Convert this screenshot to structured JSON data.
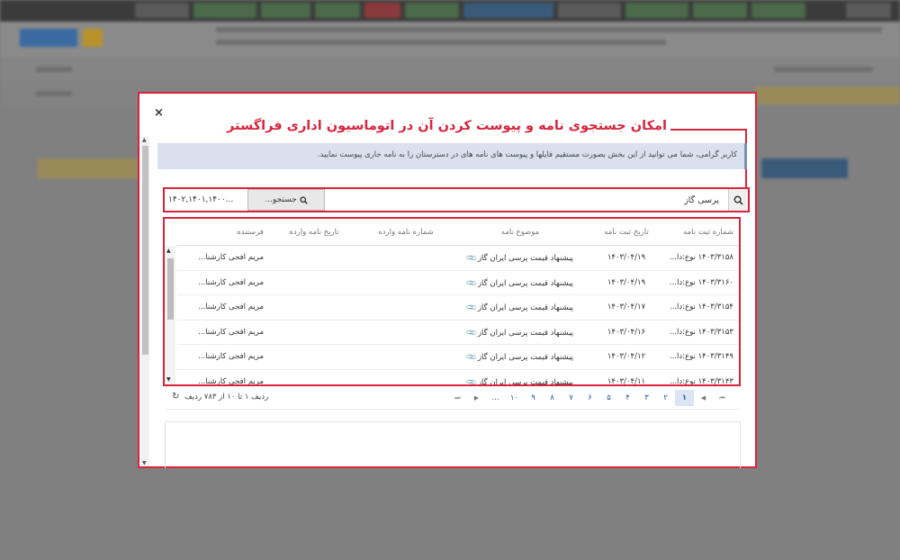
{
  "modal": {
    "close_label": "×",
    "headline": "امکان جستجوی نامه و پیوست کردن آن در اتوماسیون اداری فراگستر",
    "info": "کاربر گرامی، شما می توانید از این بخش بصورت مستقیم فایلها و پیوست های نامه های در دسترستان را به نامه جاری پیوست نمایید.",
    "search": {
      "value": "پرسی گاز",
      "button_label": "جستجو...",
      "year_value": "۱۴۰۲,۱۴۰۱,۱۴۰۰..."
    },
    "table": {
      "headers": [
        "شماره ثبت نامه",
        "تاریخ ثبت نامه",
        "موضوع نامه",
        "شماره نامه وارده",
        "تاریخ نامه وارده",
        "فرستنده"
      ],
      "rows": [
        {
          "number": "۱۴۰۳/۳۱۵۸ نوع:دا...",
          "date": "۱۴۰۳/۰۴/۱۹",
          "subject": "پیشنهاد قیمت پرسی ایران گاز",
          "in_number": "",
          "in_date": "",
          "sender": "مریم افجی کارشنا..."
        },
        {
          "number": "۱۴۰۳/۳۱۶۰ نوع:داخ...",
          "date": "۱۴۰۳/۰۴/۱۹",
          "subject": "پیشنهاد قیمت پرسی ایران گاز",
          "in_number": "",
          "in_date": "",
          "sender": "مریم افجی کارشنا..."
        },
        {
          "number": "۱۴۰۳/۳۱۵۴ نوع:دا...",
          "date": "۱۴۰۳/۰۴/۱۷",
          "subject": "پیشنهاد قیمت پرسی ایران گاز",
          "in_number": "",
          "in_date": "",
          "sender": "مریم افجی کارشنا..."
        },
        {
          "number": "۱۴۰۳/۳۱۵۳ نوع:دا...",
          "date": "۱۴۰۳/۰۴/۱۶",
          "subject": "پیشنهاد قیمت پرسی ایران گاز",
          "in_number": "",
          "in_date": "",
          "sender": "مریم افجی کارشنا..."
        },
        {
          "number": "۱۴۰۳/۳۱۴۹ نوع:دا...",
          "date": "۱۴۰۳/۰۴/۱۲",
          "subject": "پیشنهاد قیمت پرسی ایران گاز",
          "in_number": "",
          "in_date": "",
          "sender": "مریم افجی کارشنا..."
        },
        {
          "number": "۱۴۰۳/۳۱۴۳ نوع:دا...",
          "date": "۱۴۰۳/۰۴/۱۱",
          "subject": "پیشنهاد قیمت پرسی ایران گاز",
          "in_number": "",
          "in_date": "",
          "sender": "مریم افجی کارشنا..."
        }
      ]
    },
    "pager": {
      "info": "ردیف ۱ تا ۱۰ از ۷۸۳ ردیف",
      "pages": [
        "۱",
        "۲",
        "۳",
        "۴",
        "۵",
        "۶",
        "۷",
        "۸",
        "۹",
        "۱۰",
        "..."
      ],
      "active_page": "۱"
    }
  },
  "icons": {
    "search": "search-icon",
    "clip": "paperclip-icon",
    "refresh": "refresh-icon",
    "close": "close-icon"
  },
  "colors": {
    "highlight": "#d8243c",
    "info_bg": "#d9e1ef",
    "link": "#2c5aa0"
  }
}
